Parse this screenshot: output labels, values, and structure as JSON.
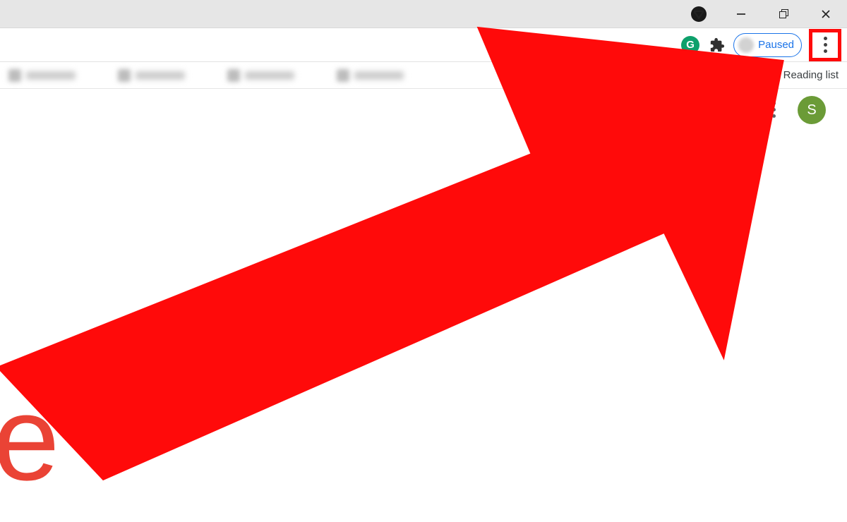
{
  "window": {
    "dropdown_icon": "down-triangle",
    "minimize_icon": "minimize",
    "maximize_icon": "maximize",
    "close_icon": "close"
  },
  "toolbar": {
    "grammarly_label": "G",
    "extensions_icon": "puzzle",
    "profile_status": "Paused",
    "menu_icon": "kebab"
  },
  "bookmarks": {
    "reading_list_label": "Reading list"
  },
  "page": {
    "apps_icon": "apps-grid",
    "avatar_letter": "S",
    "logo_letter": "e"
  },
  "annotation": {
    "highlight_target": "chrome-menu-button",
    "arrow_color": "#ff0a0a"
  }
}
